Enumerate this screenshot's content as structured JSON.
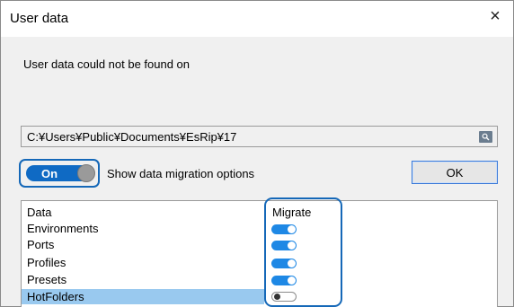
{
  "dialog": {
    "title": "User data",
    "close_glyph": "×",
    "message": "User data could not be found on",
    "path": "C:¥Users¥Public¥Documents¥EsRip¥17",
    "browse_icon": "magnifier-icon",
    "toggle": {
      "label": "On",
      "state": "on"
    },
    "show_options_label": "Show data migration options",
    "ok_label": "OK"
  },
  "table": {
    "columns": [
      "Data",
      "Migrate"
    ],
    "rows": [
      {
        "label": "Environments",
        "migrate": true
      },
      {
        "label": "Ports",
        "migrate": true
      },
      {
        "label": "Profiles",
        "migrate": true
      },
      {
        "label": "Presets",
        "migrate": true
      },
      {
        "label": "HotFolders",
        "migrate": false,
        "selected": true
      }
    ]
  },
  "colors": {
    "accent": "#1568b8",
    "switch_on": "#1e88e5",
    "selection": "#99c9ef",
    "window_bg": "#f0f0f0"
  }
}
